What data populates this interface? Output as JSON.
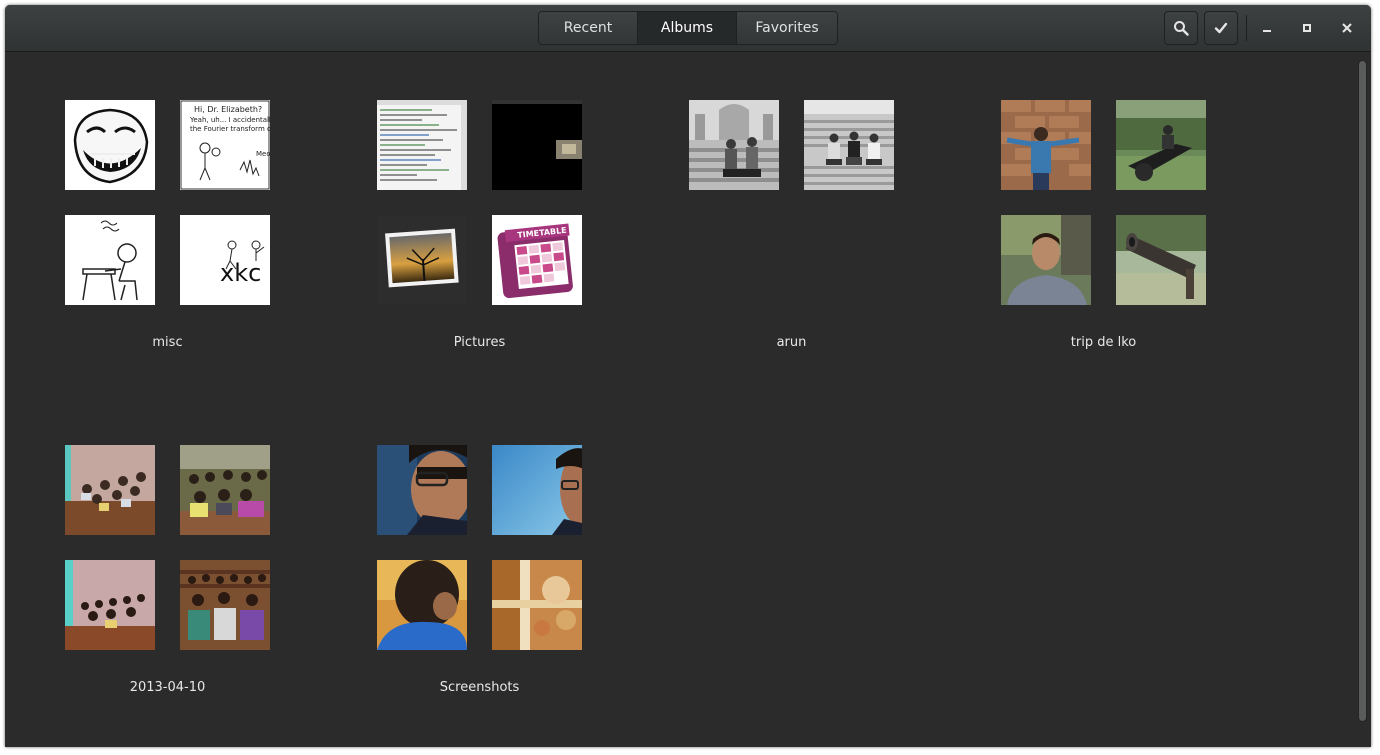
{
  "header": {
    "tabs": [
      {
        "label": "Recent"
      },
      {
        "label": "Albums"
      },
      {
        "label": "Favorites"
      }
    ],
    "active_tab": "Albums"
  },
  "icons": {
    "search": "search-icon",
    "select": "checkmark-icon",
    "minimize": "minimize-icon",
    "maximize": "maximize-icon",
    "close": "close-icon"
  },
  "albums": [
    {
      "name": "misc"
    },
    {
      "name": "Pictures"
    },
    {
      "name": "arun"
    },
    {
      "name": "trip de lko"
    },
    {
      "name": "2013-04-10"
    },
    {
      "name": "Screenshots"
    }
  ],
  "thumbnails": {
    "misc_2_text": "Hi, Dr. Elizabeth?\nYeah, uh... I accidentally\nthe Fourier transform of",
    "misc_4_text": "xkc",
    "pictures_4_text": "TIMETABLE"
  },
  "colors": {
    "window_bg": "#2b2b2b",
    "header_bg": "#363a3b",
    "active_tab_bg": "#26292a",
    "label_text": "#e8e8e8"
  }
}
